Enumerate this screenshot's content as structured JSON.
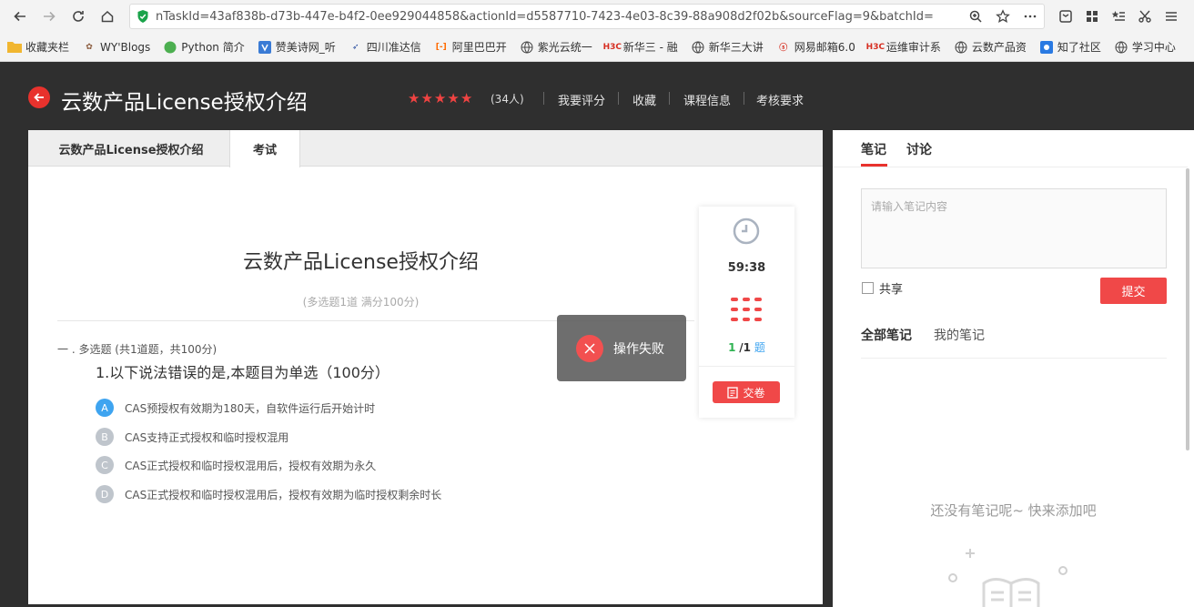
{
  "browser": {
    "url": "nTaskId=43af838b-d73b-447e-b4f2-0ee929044858&actionId=d5587710-7423-4e03-8c39-88a908d2f02b&sourceFlag=9&batchId=",
    "bookmarks": [
      {
        "label": "收藏夹栏",
        "icon": "folder-icon",
        "color": "#f1b630"
      },
      {
        "label": "WY'Blogs",
        "icon": "blog-icon",
        "color": "#8a5a3c"
      },
      {
        "label": "Python 简介",
        "icon": "python-icon",
        "color": "#4caf50"
      },
      {
        "label": "赞美诗网_听",
        "icon": "music-icon",
        "color": "#3a7bd5"
      },
      {
        "label": "四川准达信",
        "icon": "zhunda-icon",
        "color": "#2b4fa0"
      },
      {
        "label": "阿里巴巴开",
        "icon": "alibaba-icon",
        "color": "#ff6a00"
      },
      {
        "label": "紫光云统一",
        "icon": "globe-icon",
        "color": "#444"
      },
      {
        "label": "新华三 - 融",
        "icon": "h3c-icon",
        "color": "#d62d20"
      },
      {
        "label": "新华三大讲",
        "icon": "globe-icon",
        "color": "#444"
      },
      {
        "label": "网易邮箱6.0",
        "icon": "netease-icon",
        "color": "#d62d20"
      },
      {
        "label": "运维审计系",
        "icon": "h3c-icon",
        "color": "#d62d20"
      },
      {
        "label": "云数产品资",
        "icon": "globe-icon",
        "color": "#444"
      },
      {
        "label": "知了社区",
        "icon": "zhiliao-icon",
        "color": "#2a7ae2"
      },
      {
        "label": "学习中心",
        "icon": "globe-icon",
        "color": "#444"
      }
    ]
  },
  "header": {
    "title": "云数产品License授权介绍",
    "stars": 5,
    "rating_count": "(34人)",
    "links": [
      "我要评分",
      "收藏",
      "课程信息",
      "考核要求"
    ]
  },
  "tabs": [
    "云数产品License授权介绍",
    "考试"
  ],
  "exam": {
    "title": "云数产品License授权介绍",
    "subtitle": "(多选题1道 满分100分)",
    "section": "一 . 多选题 (共1道题，共100分)",
    "question": "1.以下说法错误的是,本题目为单选（100分）",
    "options": [
      {
        "letter": "A",
        "text": "CAS预授权有效期为180天，自软件运行后开始计时",
        "selected": true
      },
      {
        "letter": "B",
        "text": "CAS支持正式授权和临时授权混用",
        "selected": false
      },
      {
        "letter": "C",
        "text": "CAS正式授权和临时授权混用后，授权有效期为永久",
        "selected": false
      },
      {
        "letter": "D",
        "text": "CAS正式授权和临时授权混用后，授权有效期为临时授权剩余时长",
        "selected": false
      }
    ]
  },
  "timer": {
    "time": "59:38",
    "current": "1",
    "total": "/1",
    "unit": "题",
    "submit_label": "交卷"
  },
  "toast": {
    "message": "操作失败"
  },
  "notes": {
    "tabs": [
      "笔记",
      "讨论"
    ],
    "placeholder": "请输入笔记内容",
    "share_label": "共享",
    "submit_label": "提交",
    "filter_tabs": [
      "全部笔记",
      "我的笔记"
    ],
    "empty_message": "还没有笔记呢~ 快来添加吧"
  },
  "colors": {
    "accent": "#f04848",
    "selected_option": "#3ea4f0",
    "header_bg": "#2f2f2f"
  }
}
